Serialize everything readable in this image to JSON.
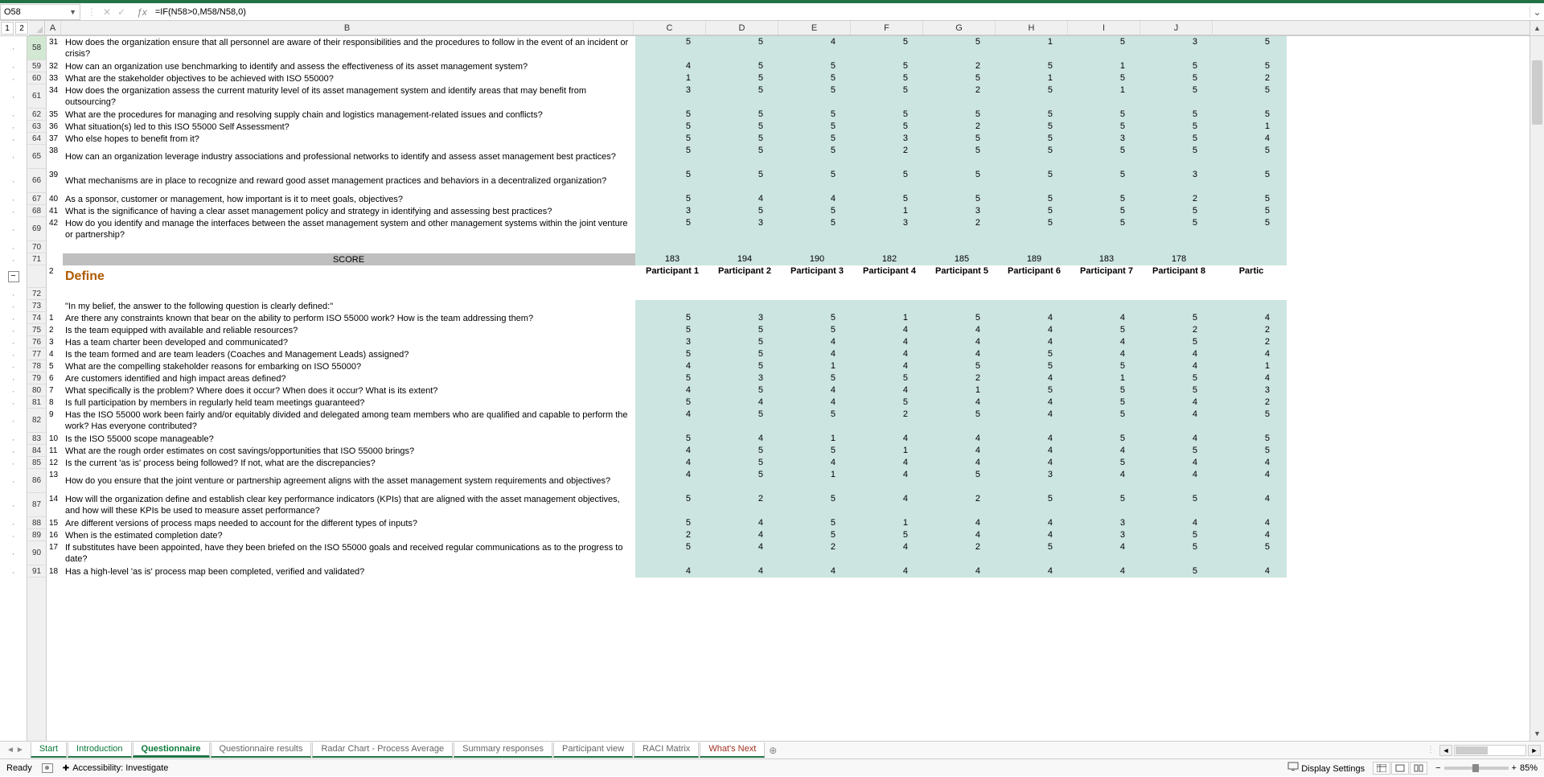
{
  "formula_bar": {
    "cell_ref": "O58",
    "formula": "=IF(N58>0,M58/N58,0)"
  },
  "columns": [
    "A",
    "B",
    "C",
    "D",
    "E",
    "F",
    "G",
    "H",
    "I",
    "J"
  ],
  "participants": [
    "Participant 1",
    "Participant 2",
    "Participant 3",
    "Participant 4",
    "Participant 5",
    "Participant 6",
    "Participant 7",
    "Participant 8",
    "Partic"
  ],
  "section2": {
    "title": "Define",
    "intro": "\"In my belief, the answer to the following question is clearly defined:\""
  },
  "rows_top": [
    {
      "r": 58,
      "a": "31",
      "tall": true,
      "b": "How does the organization ensure that all personnel are aware of their responsibilities and the procedures to follow in the event of an incident or crisis?",
      "v": [
        5,
        5,
        4,
        5,
        5,
        1,
        5,
        3,
        5
      ]
    },
    {
      "r": 59,
      "a": "32",
      "b": "How can an organization use benchmarking to identify and assess the effectiveness of its asset management system?",
      "v": [
        4,
        5,
        5,
        5,
        2,
        5,
        1,
        5,
        5
      ]
    },
    {
      "r": 60,
      "a": "33",
      "b": "What are the stakeholder objectives to be achieved with ISO 55000?",
      "v": [
        1,
        5,
        5,
        5,
        5,
        1,
        5,
        5,
        2
      ]
    },
    {
      "r": 61,
      "a": "34",
      "tall": true,
      "b": "How does the organization assess the current maturity level of its asset management system and identify areas that may benefit from outsourcing?",
      "v": [
        3,
        5,
        5,
        5,
        2,
        5,
        1,
        5,
        5
      ]
    },
    {
      "r": 62,
      "a": "35",
      "b": "What are the procedures for managing and resolving supply chain and logistics management-related issues and conflicts?",
      "v": [
        5,
        5,
        5,
        5,
        5,
        5,
        5,
        5,
        5
      ]
    },
    {
      "r": 63,
      "a": "36",
      "b": "What situation(s) led to this ISO 55000 Self Assessment?",
      "v": [
        5,
        5,
        5,
        5,
        2,
        5,
        5,
        5,
        1
      ]
    },
    {
      "r": 64,
      "a": "37",
      "b": "Who else hopes to benefit from it?",
      "v": [
        5,
        5,
        5,
        3,
        5,
        5,
        3,
        5,
        4
      ]
    },
    {
      "r": 65,
      "a": "38",
      "tall": true,
      "b": "How can an organization leverage industry associations and professional networks to identify and assess asset management best practices?",
      "v": [
        5,
        5,
        5,
        2,
        5,
        5,
        5,
        5,
        5
      ]
    },
    {
      "r": 66,
      "a": "39",
      "tall": true,
      "b": "What mechanisms are in place to recognize and reward good asset management practices and behaviors in a decentralized organization?",
      "v": [
        5,
        5,
        5,
        5,
        5,
        5,
        5,
        3,
        5
      ]
    },
    {
      "r": 67,
      "a": "40",
      "b": "As a sponsor, customer or management, how important is it to meet goals, objectives?",
      "v": [
        5,
        4,
        4,
        5,
        5,
        5,
        5,
        2,
        5
      ]
    },
    {
      "r": 68,
      "a": "41",
      "b": "What is the significance of having a clear asset management policy and strategy in identifying and assessing best practices?",
      "v": [
        3,
        5,
        5,
        1,
        3,
        5,
        5,
        5,
        5
      ]
    },
    {
      "r": 69,
      "a": "42",
      "tall": true,
      "b": "How do you identify and manage the interfaces between the asset management system and other management systems within the joint venture or partnership?",
      "v": [
        5,
        3,
        5,
        3,
        2,
        5,
        5,
        5,
        5
      ]
    }
  ],
  "score": {
    "label": "SCORE",
    "v": [
      183,
      194,
      190,
      182,
      185,
      189,
      183,
      178,
      ""
    ]
  },
  "rows_bottom": [
    {
      "r": 74,
      "a": "1",
      "b": "Are there any constraints known that bear on the ability to perform ISO 55000 work? How is the team addressing them?",
      "v": [
        5,
        3,
        5,
        1,
        5,
        4,
        4,
        5,
        4
      ]
    },
    {
      "r": 75,
      "a": "2",
      "b": "Is the team equipped with available and reliable resources?",
      "v": [
        5,
        5,
        5,
        4,
        4,
        4,
        5,
        2,
        2
      ]
    },
    {
      "r": 76,
      "a": "3",
      "b": "Has a team charter been developed and communicated?",
      "v": [
        3,
        5,
        4,
        4,
        4,
        4,
        4,
        5,
        2
      ]
    },
    {
      "r": 77,
      "a": "4",
      "b": "Is the team formed and are team leaders (Coaches and Management Leads) assigned?",
      "v": [
        5,
        5,
        4,
        4,
        4,
        5,
        4,
        4,
        4
      ]
    },
    {
      "r": 78,
      "a": "5",
      "b": "What are the compelling stakeholder reasons for embarking on ISO 55000?",
      "v": [
        4,
        5,
        1,
        4,
        5,
        5,
        5,
        4,
        1
      ]
    },
    {
      "r": 79,
      "a": "6",
      "b": "Are customers identified and high impact areas defined?",
      "v": [
        5,
        3,
        5,
        5,
        2,
        4,
        1,
        5,
        4
      ]
    },
    {
      "r": 80,
      "a": "7",
      "b": "What specifically is the problem? Where does it occur? When does it occur? What is its extent?",
      "v": [
        4,
        5,
        4,
        4,
        1,
        5,
        5,
        5,
        3
      ]
    },
    {
      "r": 81,
      "a": "8",
      "b": "Is full participation by members in regularly held team meetings guaranteed?",
      "v": [
        5,
        4,
        4,
        5,
        4,
        4,
        5,
        4,
        2
      ]
    },
    {
      "r": 82,
      "a": "9",
      "tall": true,
      "b": "Has the ISO 55000 work been fairly and/or equitably divided and delegated among team members who are qualified and capable to perform the work? Has everyone contributed?",
      "v": [
        4,
        5,
        5,
        2,
        5,
        4,
        5,
        4,
        5
      ]
    },
    {
      "r": 83,
      "a": "10",
      "b": "Is the ISO 55000 scope manageable?",
      "v": [
        5,
        4,
        1,
        4,
        4,
        4,
        5,
        4,
        5
      ]
    },
    {
      "r": 84,
      "a": "11",
      "b": "What are the rough order estimates on cost savings/opportunities that ISO 55000 brings?",
      "v": [
        4,
        5,
        5,
        1,
        4,
        4,
        4,
        5,
        5
      ]
    },
    {
      "r": 85,
      "a": "12",
      "b": "Is the current 'as is' process being followed? If not, what are the discrepancies?",
      "v": [
        4,
        5,
        4,
        4,
        4,
        4,
        5,
        4,
        4
      ]
    },
    {
      "r": 86,
      "a": "13",
      "tall": true,
      "b": "How do you ensure that the joint venture or partnership agreement aligns with the asset management system requirements and objectives?",
      "v": [
        4,
        5,
        1,
        4,
        5,
        3,
        4,
        4,
        4
      ]
    },
    {
      "r": 87,
      "a": "14",
      "tall": true,
      "b": "How will the organization define and establish clear key performance indicators (KPIs) that are aligned with the asset management objectives, and how will these KPIs be used to measure asset performance?",
      "v": [
        5,
        2,
        5,
        4,
        2,
        5,
        5,
        5,
        4
      ]
    },
    {
      "r": 88,
      "a": "15",
      "b": "Are different versions of process maps needed to account for the different types of inputs?",
      "v": [
        5,
        4,
        5,
        1,
        4,
        4,
        3,
        4,
        4
      ]
    },
    {
      "r": 89,
      "a": "16",
      "b": "When is the estimated completion date?",
      "v": [
        2,
        4,
        5,
        5,
        4,
        4,
        3,
        5,
        4
      ]
    },
    {
      "r": 90,
      "a": "17",
      "tall": true,
      "b": "If substitutes have been appointed, have they been briefed on the ISO 55000 goals and received regular communications as to the progress to date?",
      "v": [
        5,
        4,
        2,
        4,
        2,
        5,
        4,
        5,
        5
      ]
    },
    {
      "r": 91,
      "a": "18",
      "b": "Has a high-level 'as is' process map been completed, verified and validated?",
      "v": [
        4,
        4,
        4,
        4,
        4,
        4,
        4,
        5,
        4
      ]
    }
  ],
  "tabs": [
    {
      "label": "Start",
      "cls": "accent green"
    },
    {
      "label": "Introduction",
      "cls": "accent green"
    },
    {
      "label": "Questionnaire",
      "cls": "active"
    },
    {
      "label": "Questionnaire results",
      "cls": "accent gray"
    },
    {
      "label": "Radar Chart - Process Average",
      "cls": "accent gray"
    },
    {
      "label": "Summary responses",
      "cls": "accent gray"
    },
    {
      "label": "Participant view",
      "cls": "accent gray"
    },
    {
      "label": "RACI Matrix",
      "cls": "accent gray"
    },
    {
      "label": "What's Next",
      "cls": "accent red"
    }
  ],
  "status": {
    "ready": "Ready",
    "acc": "Accessibility: Investigate",
    "disp": "Display Settings",
    "zoom": "85%"
  }
}
